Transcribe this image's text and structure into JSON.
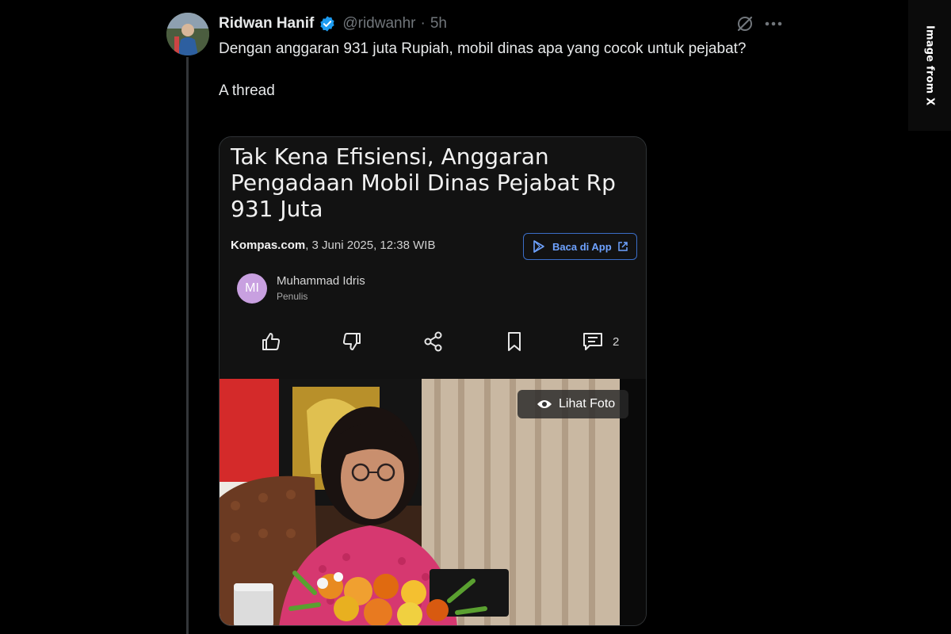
{
  "overlay": {
    "side_label": "Image from X"
  },
  "tweet": {
    "author": {
      "display_name": "Ridwan Hanif",
      "handle": "@ridwanhr",
      "time": "5h"
    },
    "text_line1": "Dengan anggaran 931 juta Rupiah, mobil dinas apa yang cocok untuk pejabat?",
    "text_line2": "A thread"
  },
  "article": {
    "headline": "Tak Kena Efisiensi, Anggaran Pengadaan Mobil Dinas Pejabat Rp 931 Juta",
    "source": "Kompas.com",
    "date": ", 3 Juni 2025, 12:38 WIB",
    "app_button": "Baca di App",
    "author_initials": "MI",
    "author_name": "Muhammad Idris",
    "author_role": "Penulis",
    "comment_count": "2",
    "photo_button": "Lihat Foto"
  },
  "colors": {
    "accent_blue": "#1d9bf0",
    "app_button_blue": "#3b6ec8",
    "author_avatar": "#c8a0e0"
  },
  "icons": [
    "verified-badge-icon",
    "grok-icon",
    "more-icon",
    "play-store-icon",
    "external-link-icon",
    "thumbs-up-icon",
    "thumbs-down-icon",
    "share-icon",
    "bookmark-icon",
    "comment-icon",
    "eye-icon"
  ]
}
